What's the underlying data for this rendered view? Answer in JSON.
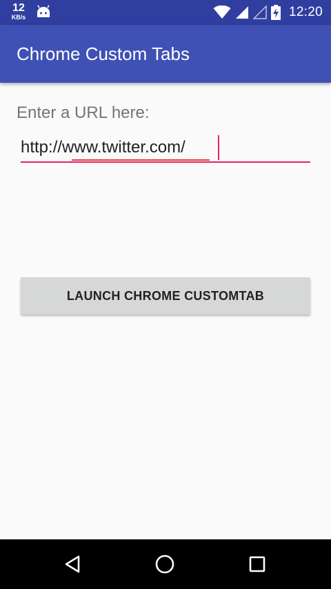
{
  "status_bar": {
    "net_speed_value": "12",
    "net_speed_unit": "KB/s",
    "time": "12:20",
    "icons": [
      "android-icon",
      "wifi-icon",
      "cell-signal-icon",
      "cell-signal-empty-icon",
      "battery-charging-icon"
    ]
  },
  "app_bar": {
    "title": "Chrome Custom Tabs"
  },
  "main": {
    "prompt_label": "Enter a URL here:",
    "url_value": "http://www.twitter.com/",
    "launch_button_label": "LAUNCH CHROME CUSTOMTAB"
  },
  "nav_bar": {
    "icons": [
      "back-icon",
      "home-icon",
      "recents-icon"
    ]
  },
  "colors": {
    "status_bar": "#303f9f",
    "app_bar": "#3f51b5",
    "accent": "#e91e63",
    "background": "#fafafa",
    "button": "#d6d7d7"
  }
}
